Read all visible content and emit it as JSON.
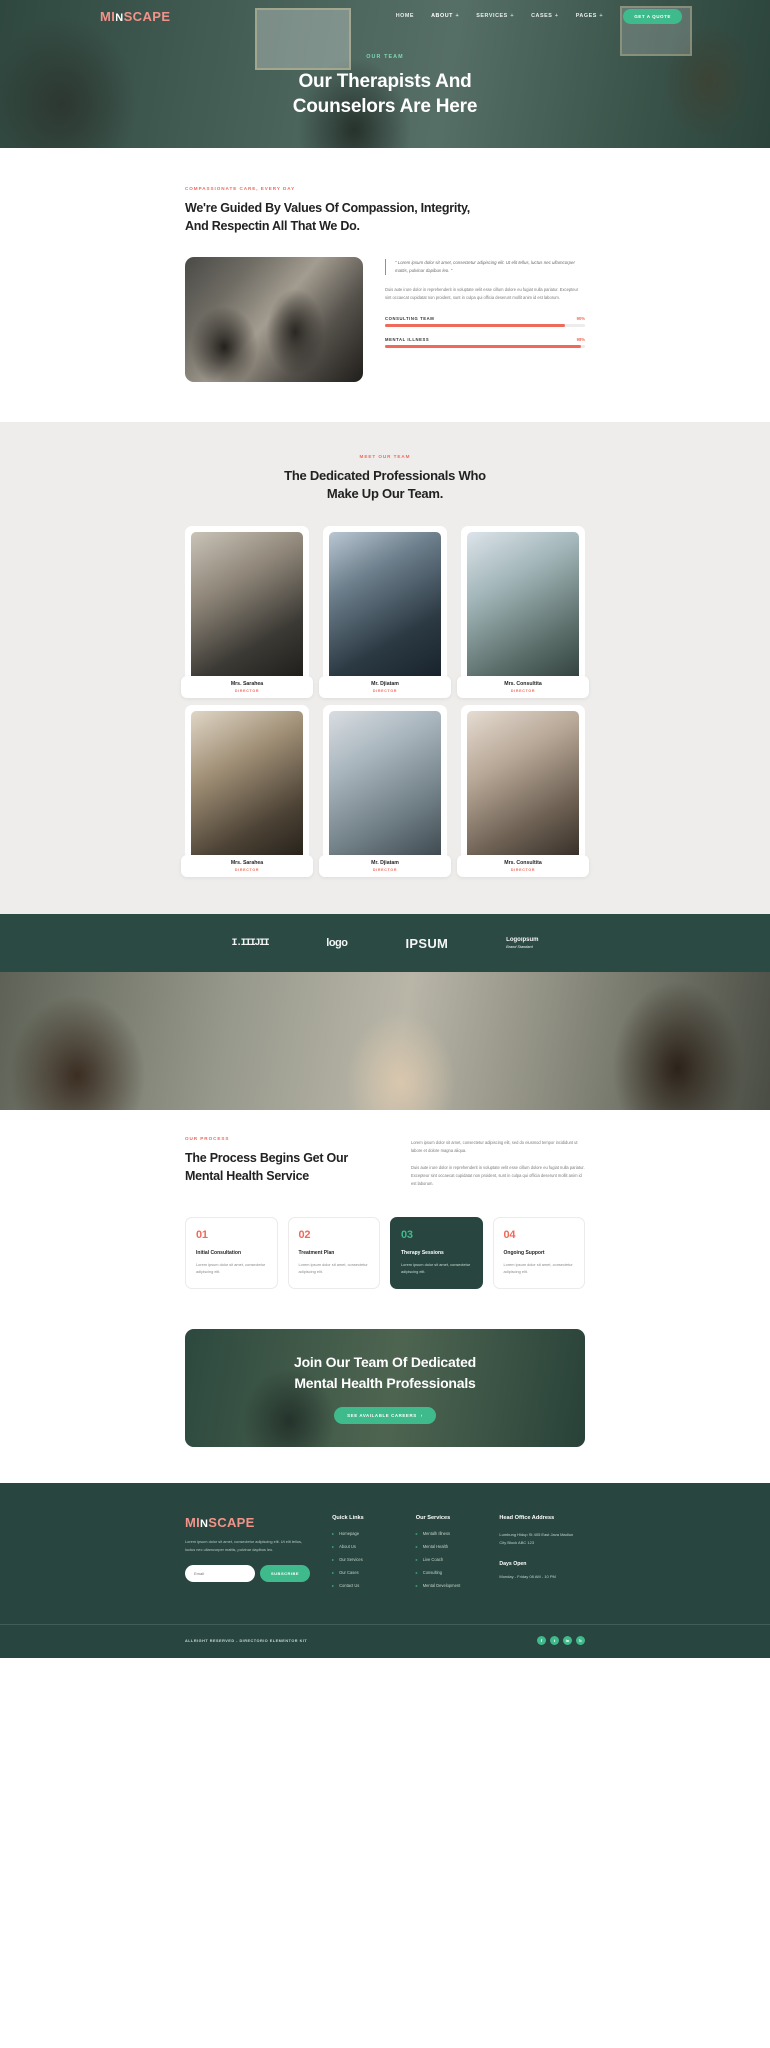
{
  "brand": {
    "part1": "MI",
    "part2": "N",
    "part3": "SCAPE"
  },
  "nav": {
    "items": [
      {
        "label": "HOME",
        "has_dropdown": false
      },
      {
        "label": "ABOUT",
        "has_dropdown": true
      },
      {
        "label": "SERVICES",
        "has_dropdown": true
      },
      {
        "label": "CASES",
        "has_dropdown": true
      },
      {
        "label": "PAGES",
        "has_dropdown": true
      }
    ],
    "cta": "GET A QUOTE"
  },
  "hero": {
    "eyebrow": "OUR TEAM",
    "title_line1": "Our Therapists And",
    "title_line2": "Counselors Are Here"
  },
  "values": {
    "eyebrow": "COMPASSIONATE CARE, EVERY DAY",
    "title_line1": "We're Guided By Values Of Compassion, Integrity,",
    "title_line2": "And Respectin All That We Do.",
    "quote": "\" Lorem ipsum dolor sit amet, consectetur adipiscing elit. Ut elit tellus, luctus nec ullamcorper mattis, pulvinar dapibus leo. \"",
    "paragraph": "Duis aute irure dolor in reprehenderit in voluptate velit esse cillum dolore eu fugiat nulla pariatur. Excepteur sint occaecat cupidatat non proident, sunt in culpa qui officia deserunt mollit anim id est laborum.",
    "bars": [
      {
        "label": "CONSULTING TEAM",
        "percent": "90%",
        "value": 90
      },
      {
        "label": "MENTAL ILLNESS",
        "percent": "98%",
        "value": 98
      }
    ]
  },
  "team": {
    "eyebrow": "MEET OUR TEAM",
    "title_line1": "The Dedicated Professionals Who",
    "title_line2": "Make Up Our Team.",
    "members": [
      {
        "name": "Mrs. Sarahea",
        "role": "DIRECTOR",
        "photo_class": "t1"
      },
      {
        "name": "Mr. Djiatam",
        "role": "DIRECTOR",
        "photo_class": "t2"
      },
      {
        "name": "Mrs. Consultita",
        "role": "DIRECTOR",
        "photo_class": "t3"
      },
      {
        "name": "Mrs. Sarahea",
        "role": "DIRECTOR",
        "photo_class": "t4"
      },
      {
        "name": "Mr. Djiatam",
        "role": "DIRECTOR",
        "photo_class": "t5"
      },
      {
        "name": "Mrs. Consultita",
        "role": "DIRECTOR",
        "photo_class": "t6"
      }
    ]
  },
  "brands": [
    {
      "text": "I.IIIJII",
      "style": "b1"
    },
    {
      "text": "logo",
      "style": "b2"
    },
    {
      "text": "IPSUM",
      "style": "b3"
    },
    {
      "text": "Logoipsum",
      "sub": "Brand Standard",
      "style": "b4"
    }
  ],
  "process": {
    "eyebrow": "OUR PROCESS",
    "title_line1": "The Process Begins Get Our",
    "title_line2": "Mental Health Service",
    "paragraph1": "Lorem ipsum dolor sit amet, consectetur adipiscing elit, sed do eiusmod tempor incididunt ut labore et dolore magna aliqua.",
    "paragraph2": "Duis aute irure dolor in reprehenderit in voluptate velit esse cillum dolore eu fugiat nulla pariatur. Excepteur sint occaecat cupidatat non proident, sunt in culpa qui officia deserunt mollit anim id est laborum.",
    "steps": [
      {
        "num": "01",
        "name": "Initial Consultation",
        "desc": "Lorem ipsum dolor sit amet, consectetur adipiscing elit.",
        "dark": false
      },
      {
        "num": "02",
        "name": "Treatment Plan",
        "desc": "Lorem ipsum dolor sit amet, consectetur adipiscing elit.",
        "dark": false
      },
      {
        "num": "03",
        "name": "Therapy Sessions",
        "desc": "Lorem ipsum dolor sit amet, consectetur adipiscing elit.",
        "dark": true
      },
      {
        "num": "04",
        "name": "Ongoing Support",
        "desc": "Lorem ipsum dolor sit amet, consectetur adipiscing elit.",
        "dark": false
      }
    ]
  },
  "cta": {
    "title_line1": "Join Our Team Of Dedicated",
    "title_line2": "Mental Health Professionals",
    "button": "SEE AVAILABLE CAREERS"
  },
  "footer": {
    "description": "Lorem ipsum dolor sit amet, consectetur adipiscing elit. Ut elit tellus, luctus nec ullamcorper mattis, pulvinar dapibus leo.",
    "email_placeholder": "Email",
    "subscribe": "SUBSCRIBE",
    "quick_links": {
      "heading": "Quick Links",
      "items": [
        "Homepage",
        "About Us",
        "Our Services",
        "Our Cases",
        "Contact Us"
      ]
    },
    "our_services": {
      "heading": "Our Services",
      "items": [
        "Mentalh Illness",
        "Mental Health",
        "Live Coach",
        "Consulting",
        "Mental Development"
      ]
    },
    "address": {
      "heading": "Head Office Address",
      "line1": "Lumbung Hidup St 405 East Java Madiun",
      "line2": "City Block ABC 123",
      "days_heading": "Days Open",
      "days_value": "Monday - Friday 08 AM - 10 PM"
    },
    "copyright": "ALLRIGHT RESERVED - DIRECTORIO ELEMENTOR KIT",
    "socials": [
      "f",
      "t",
      "in",
      "b"
    ]
  },
  "colors": {
    "accent_green": "#3fba8c",
    "accent_coral": "#ef6a5a",
    "dark_green": "#28463f",
    "salmon": "#f2938a"
  }
}
